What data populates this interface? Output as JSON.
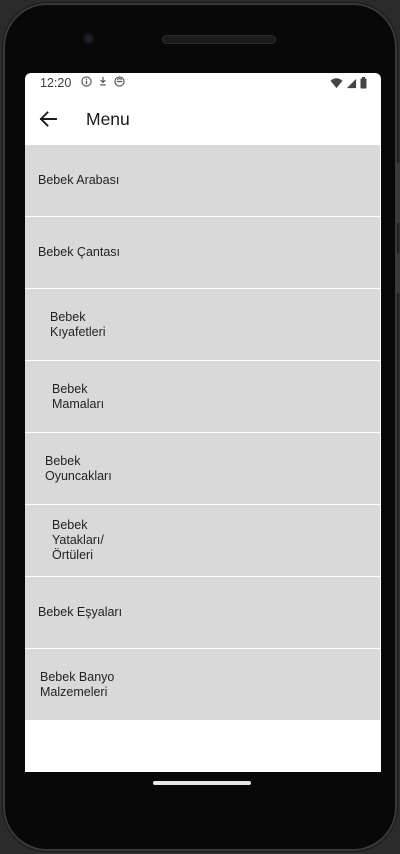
{
  "status_bar": {
    "time": "12:20",
    "left_icons": [
      "info-icon",
      "download-icon",
      "notification-icon"
    ],
    "right_icons": [
      "wifi-icon",
      "signal-icon",
      "battery-icon"
    ]
  },
  "app_bar": {
    "title": "Menu",
    "back_icon": "arrow-left-icon"
  },
  "menu": {
    "items": [
      {
        "label": "Bebek Arabası",
        "indent": 13
      },
      {
        "label": "Bebek Çantası",
        "indent": 13
      },
      {
        "label": "Bebek\nKıyafetleri",
        "indent": 25
      },
      {
        "label": "Bebek\nMamaları",
        "indent": 27
      },
      {
        "label": "Bebek\nOyuncakları",
        "indent": 20
      },
      {
        "label": "Bebek\nYatakları/\nÖrtüleri",
        "indent": 27
      },
      {
        "label": "Bebek Eşyaları",
        "indent": 13
      },
      {
        "label": "Bebek Banyo\nMalzemeleri",
        "indent": 15
      }
    ]
  },
  "colors": {
    "item_bg": "#d9d9d9",
    "screen_bg": "#ffffff",
    "device_frame": "#080808"
  }
}
